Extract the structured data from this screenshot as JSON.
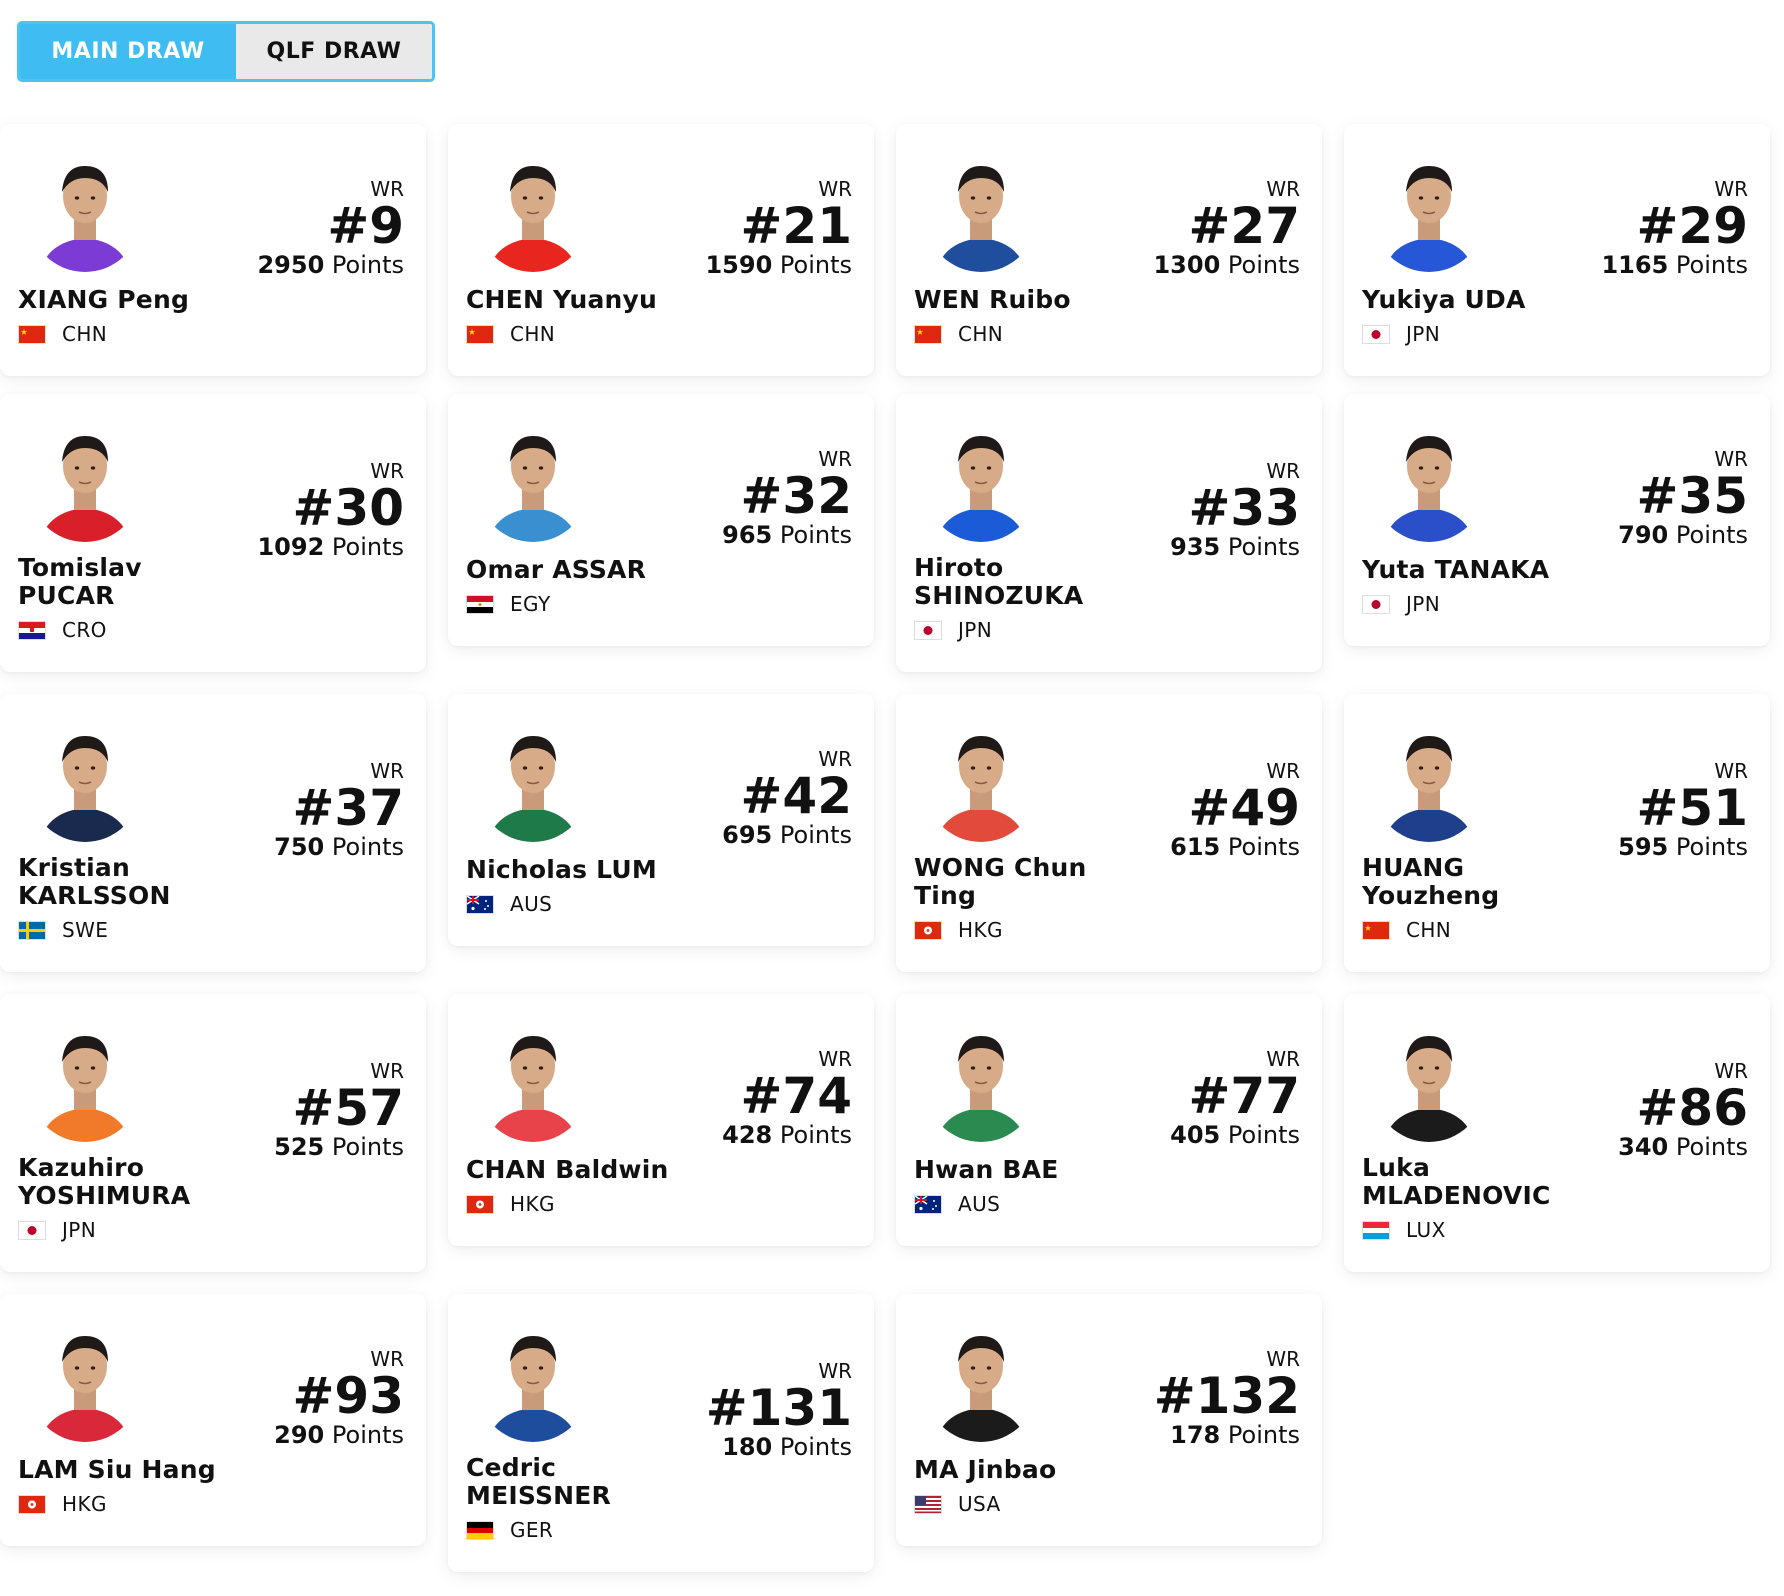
{
  "tabs": [
    {
      "label": "MAIN DRAW",
      "active": true
    },
    {
      "label": "QLF DRAW",
      "active": false
    }
  ],
  "labels": {
    "wr": "WR",
    "points_suffix": "Points"
  },
  "players": [
    {
      "name": "XIANG Peng",
      "rank": "#9",
      "points": "2950",
      "country": "CHN",
      "jersey": "#7d3bd6"
    },
    {
      "name": "CHEN Yuanyu",
      "rank": "#21",
      "points": "1590",
      "country": "CHN",
      "jersey": "#e8261f"
    },
    {
      "name": "WEN Ruibo",
      "rank": "#27",
      "points": "1300",
      "country": "CHN",
      "jersey": "#1f4e9e"
    },
    {
      "name": "Yukiya UDA",
      "rank": "#29",
      "points": "1165",
      "country": "JPN",
      "jersey": "#2557d6"
    },
    {
      "name": "Tomislav\nPUCAR",
      "rank": "#30",
      "points": "1092",
      "country": "CRO",
      "jersey": "#d91f2a"
    },
    {
      "name": "Omar ASSAR",
      "rank": "#32",
      "points": "965",
      "country": "EGY",
      "jersey": "#3a8fd0"
    },
    {
      "name": "Hiroto\nSHINOZUKA",
      "rank": "#33",
      "points": "935",
      "country": "JPN",
      "jersey": "#1c5bd8"
    },
    {
      "name": "Yuta TANAKA",
      "rank": "#35",
      "points": "790",
      "country": "JPN",
      "jersey": "#2a4fc9"
    },
    {
      "name": "Kristian\nKARLSSON",
      "rank": "#37",
      "points": "750",
      "country": "SWE",
      "jersey": "#1a2a4e"
    },
    {
      "name": "Nicholas LUM",
      "rank": "#42",
      "points": "695",
      "country": "AUS",
      "jersey": "#1f7a4a"
    },
    {
      "name": "WONG Chun\nTing",
      "rank": "#49",
      "points": "615",
      "country": "HKG",
      "jersey": "#e24a3c"
    },
    {
      "name": "HUANG\nYouzheng",
      "rank": "#51",
      "points": "595",
      "country": "CHN",
      "jersey": "#1d3f8c"
    },
    {
      "name": "Kazuhiro\nYOSHIMURA",
      "rank": "#57",
      "points": "525",
      "country": "JPN",
      "jersey": "#f07a2a"
    },
    {
      "name": "CHAN Baldwin",
      "rank": "#74",
      "points": "428",
      "country": "HKG",
      "jersey": "#e8434a"
    },
    {
      "name": "Hwan BAE",
      "rank": "#77",
      "points": "405",
      "country": "AUS",
      "jersey": "#2b8a4f"
    },
    {
      "name": "Luka\nMLADENOVIC",
      "rank": "#86",
      "points": "340",
      "country": "LUX",
      "jersey": "#1b1b1b"
    },
    {
      "name": "LAM Siu Hang",
      "rank": "#93",
      "points": "290",
      "country": "HKG",
      "jersey": "#d9283a"
    },
    {
      "name": "Cedric\nMEISSNER",
      "rank": "#131",
      "points": "180",
      "country": "GER",
      "jersey": "#1f4d9e"
    },
    {
      "name": "MA Jinbao",
      "rank": "#132",
      "points": "178",
      "country": "USA",
      "jersey": "#1b1b1b"
    }
  ]
}
